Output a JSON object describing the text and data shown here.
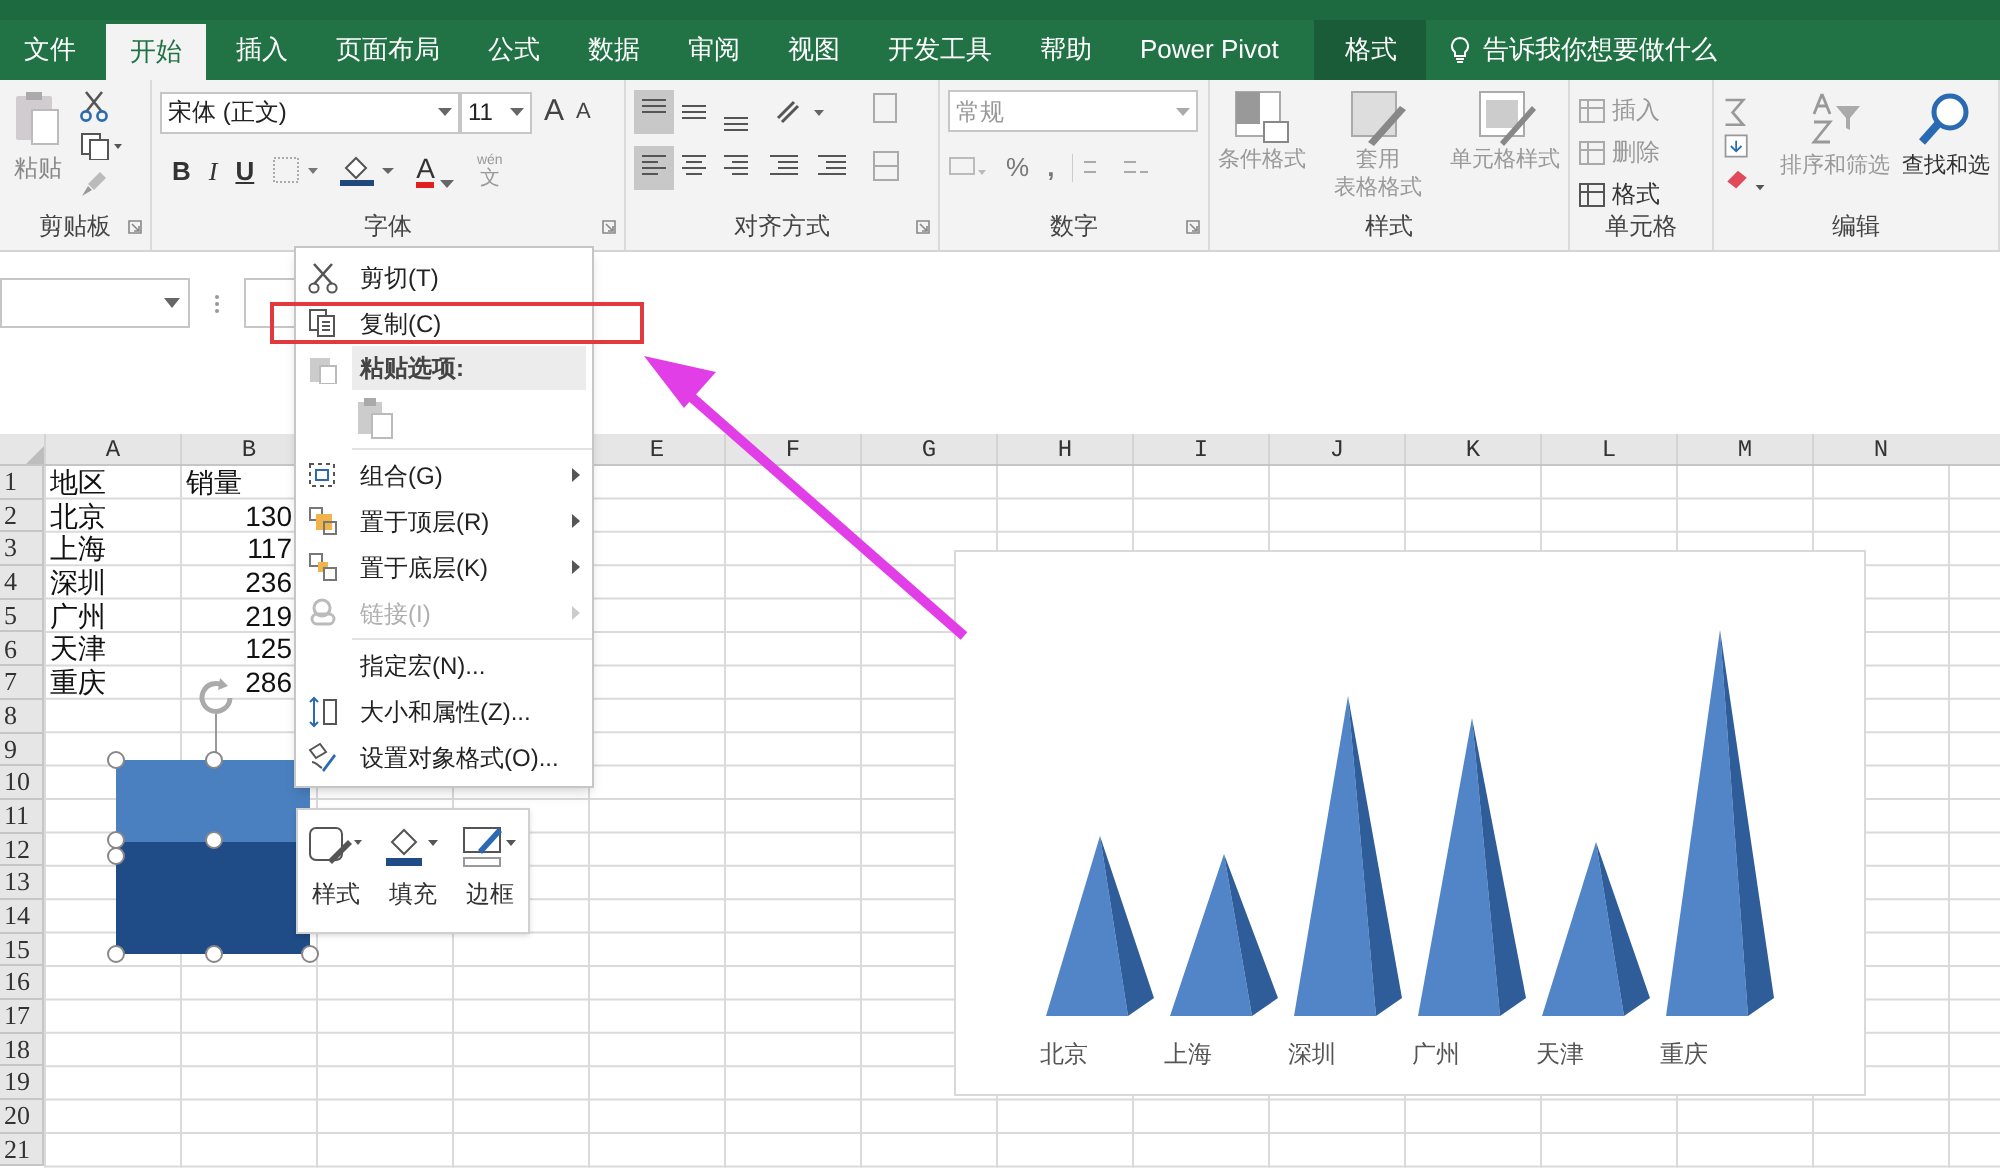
{
  "tabs": [
    {
      "label": "文件",
      "selected": false,
      "kind": "normal"
    },
    {
      "label": "开始",
      "selected": true,
      "kind": "normal"
    },
    {
      "label": "插入",
      "selected": false,
      "kind": "normal"
    },
    {
      "label": "页面布局",
      "selected": false,
      "kind": "normal"
    },
    {
      "label": "公式",
      "selected": false,
      "kind": "normal"
    },
    {
      "label": "数据",
      "selected": false,
      "kind": "normal"
    },
    {
      "label": "审阅",
      "selected": false,
      "kind": "normal"
    },
    {
      "label": "视图",
      "selected": false,
      "kind": "normal"
    },
    {
      "label": "开发工具",
      "selected": false,
      "kind": "normal"
    },
    {
      "label": "帮助",
      "selected": false,
      "kind": "normal"
    },
    {
      "label": "Power Pivot",
      "selected": false,
      "kind": "normal"
    },
    {
      "label": "格式",
      "selected": false,
      "kind": "contextual"
    }
  ],
  "tell_me": "告诉我你想要做什么",
  "ribbon": {
    "clipboard": {
      "label": "剪贴板",
      "paste": "粘贴"
    },
    "font": {
      "label": "字体",
      "font_name": "宋体 (正文)",
      "font_size": "11",
      "grow": "A",
      "shrink": "A",
      "bold": "B",
      "italic": "I",
      "underline": "U",
      "font_color": "A",
      "phonetic_ruby": "wén",
      "phonetic": "文"
    },
    "alignment": {
      "label": "对齐方式"
    },
    "number": {
      "label": "数字",
      "format": "常规",
      "percent": "%",
      "comma": ","
    },
    "styles": {
      "label": "样式",
      "buttons": [
        [
          "条件格式"
        ],
        [
          "套用",
          "表格格式"
        ],
        [
          "单元格样式"
        ]
      ]
    },
    "cells": {
      "label": "单元格",
      "items": [
        "插入",
        "删除",
        "格式"
      ]
    },
    "editing": {
      "label": "编辑",
      "sort": "排序和筛选",
      "find": "查找和选"
    }
  },
  "sheet": {
    "columns_left": [
      "A",
      "B"
    ],
    "columns_right": [
      "E",
      "F",
      "G",
      "H",
      "I",
      "J",
      "K",
      "L",
      "M",
      "N"
    ],
    "rows": [
      "1",
      "2",
      "3",
      "4",
      "5",
      "6",
      "7",
      "8",
      "9",
      "10",
      "11",
      "12",
      "13",
      "14",
      "15",
      "16",
      "17",
      "18",
      "19",
      "20",
      "21"
    ],
    "cells": [
      [
        "地区",
        "销量"
      ],
      [
        "北京",
        "130"
      ],
      [
        "上海",
        "117"
      ],
      [
        "深圳",
        "236"
      ],
      [
        "广州",
        "219"
      ],
      [
        "天津",
        "125"
      ],
      [
        "重庆",
        "286"
      ]
    ]
  },
  "context_menu": {
    "items": [
      {
        "kind": "command",
        "label": "剪切(T)",
        "disabled": false,
        "submenu": false,
        "annotated": false
      },
      {
        "kind": "command",
        "label": "复制(C)",
        "disabled": false,
        "submenu": false,
        "annotated": true
      },
      {
        "kind": "header",
        "label": "粘贴选项:"
      },
      {
        "kind": "paste_options"
      },
      {
        "kind": "command",
        "label": "组合(G)",
        "disabled": false,
        "submenu": true,
        "annotated": false
      },
      {
        "kind": "command",
        "label": "置于顶层(R)",
        "disabled": false,
        "submenu": true,
        "annotated": false
      },
      {
        "kind": "command",
        "label": "置于底层(K)",
        "disabled": false,
        "submenu": true,
        "annotated": false
      },
      {
        "kind": "command",
        "label": "链接(I)",
        "disabled": true,
        "submenu": true,
        "annotated": false
      },
      {
        "kind": "command",
        "label": "指定宏(N)...",
        "disabled": false,
        "submenu": false,
        "annotated": false
      },
      {
        "kind": "command",
        "label": "大小和属性(Z)...",
        "disabled": false,
        "submenu": false,
        "annotated": false
      },
      {
        "kind": "command",
        "label": "设置对象格式(O)...",
        "disabled": false,
        "submenu": false,
        "annotated": false
      }
    ]
  },
  "mini_toolbar": {
    "buttons": [
      "样式",
      "填充",
      "边框"
    ]
  },
  "chart": {
    "categories": [
      "北京",
      "上海",
      "深圳",
      "广州",
      "天津",
      "重庆"
    ]
  }
}
